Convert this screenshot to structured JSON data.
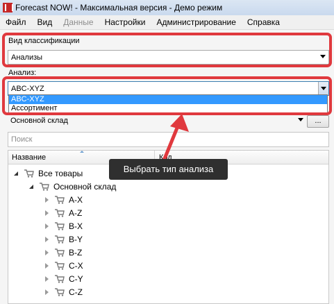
{
  "window": {
    "title": "Forecast NOW! - Максимальная версия - Демо режим"
  },
  "menubar": {
    "items": [
      {
        "label": "Файл",
        "enabled": true
      },
      {
        "label": "Вид",
        "enabled": true
      },
      {
        "label": "Данные",
        "enabled": false
      },
      {
        "label": "Настройки",
        "enabled": true
      },
      {
        "label": "Администрирование",
        "enabled": true
      },
      {
        "label": "Справка",
        "enabled": true
      }
    ]
  },
  "classification": {
    "label": "Вид классификации",
    "value": "Анализы"
  },
  "analysis": {
    "label": "Анализ:",
    "value": "ABC-XYZ",
    "options": [
      "ABC-XYZ",
      "Ассортимент"
    ],
    "selected_index": 0
  },
  "warehouse": {
    "value": "Основной склад",
    "browse_label": "..."
  },
  "search": {
    "placeholder": "Поиск"
  },
  "grid": {
    "columns": [
      "Название",
      "Код"
    ],
    "rows": [
      {
        "label": "Все товары",
        "level": 0,
        "state": "open"
      },
      {
        "label": "Основной склад",
        "level": 1,
        "state": "open"
      },
      {
        "label": "A-X",
        "level": 2,
        "state": "closed"
      },
      {
        "label": "A-Z",
        "level": 2,
        "state": "closed"
      },
      {
        "label": "B-X",
        "level": 2,
        "state": "closed"
      },
      {
        "label": "B-Y",
        "level": 2,
        "state": "closed"
      },
      {
        "label": "B-Z",
        "level": 2,
        "state": "closed"
      },
      {
        "label": "C-X",
        "level": 2,
        "state": "closed"
      },
      {
        "label": "C-Y",
        "level": 2,
        "state": "closed"
      },
      {
        "label": "C-Z",
        "level": 2,
        "state": "closed"
      }
    ]
  },
  "tooltip": {
    "text": "Выбрать тип анализа"
  },
  "colors": {
    "highlight": "#e0393e",
    "selection": "#3399ff"
  }
}
